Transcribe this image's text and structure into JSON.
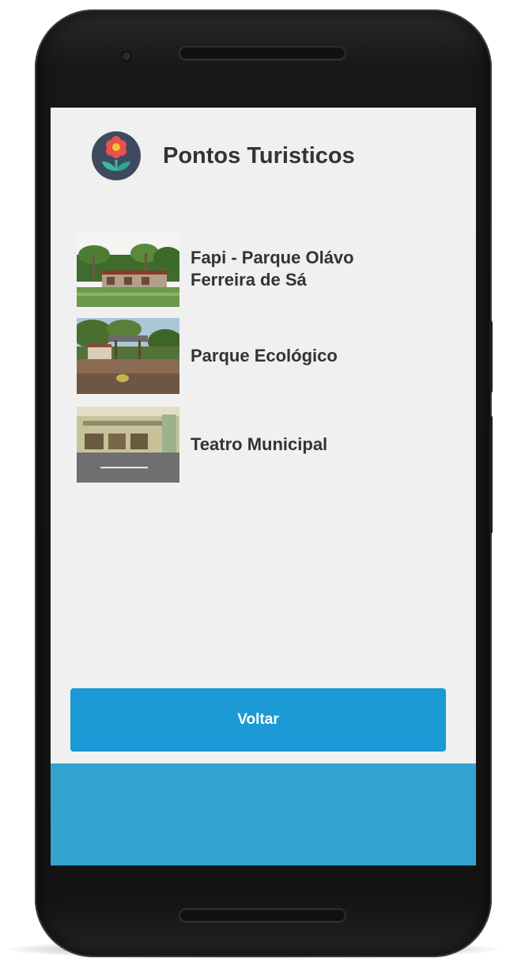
{
  "app": {
    "title": "Pontos Turisticos",
    "logo_icon": "flower-icon"
  },
  "places": [
    {
      "label_line1": "Fapi - Parque Olávo",
      "label_line2": "Ferreira de Sá",
      "thumbnail": "park-pavilion-photo"
    },
    {
      "label_line1": "Parque Ecológico",
      "label_line2": "",
      "thumbnail": "ecological-park-photo"
    },
    {
      "label_line1": "Teatro Municipal",
      "label_line2": "",
      "thumbnail": "theater-facade-photo"
    }
  ],
  "actions": {
    "back_label": "Voltar"
  },
  "colors": {
    "screen_bg": "#f0f0f0",
    "button": "#1b9ad5",
    "footer": "#32a4cf",
    "logo_bg": "#3e4b5f",
    "text": "#333333"
  }
}
